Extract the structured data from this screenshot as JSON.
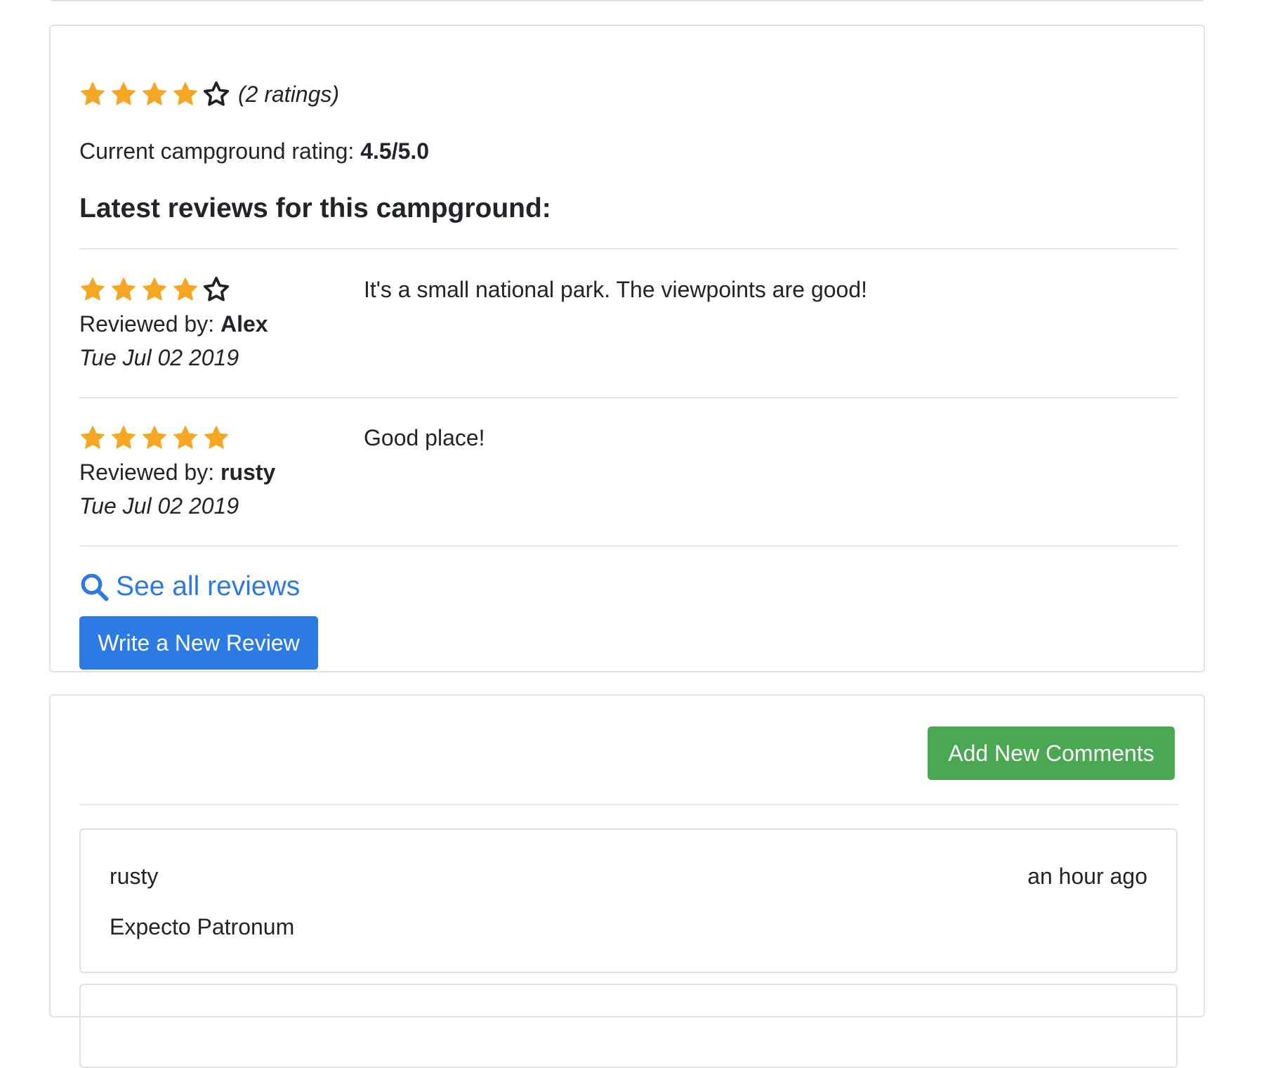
{
  "summary": {
    "rating_stars": 4,
    "max_stars": 5,
    "ratings_count_text": "(2 ratings)",
    "current_rating_label": "Current campground rating: ",
    "current_rating_value": "4.5/5.0",
    "heading": "Latest reviews for this campground:"
  },
  "reviews": [
    {
      "stars": 4,
      "reviewed_by_label": "Reviewed by: ",
      "author": "Alex",
      "date": "Tue Jul 02 2019",
      "text": "It's a small national park. The viewpoints are good!"
    },
    {
      "stars": 5,
      "reviewed_by_label": "Reviewed by: ",
      "author": "rusty",
      "date": "Tue Jul 02 2019",
      "text": "Good place!"
    }
  ],
  "actions": {
    "see_all_label": "See all reviews",
    "write_review_label": "Write a New Review",
    "add_comment_label": "Add New Comments"
  },
  "comments": [
    {
      "author": "rusty",
      "time": "an hour ago",
      "text": "Expecto Patronum"
    }
  ],
  "colors": {
    "star": "#f5a623",
    "link": "#2a7ae2",
    "primary_button": "#2c7be5",
    "success_button": "#4aa752"
  }
}
